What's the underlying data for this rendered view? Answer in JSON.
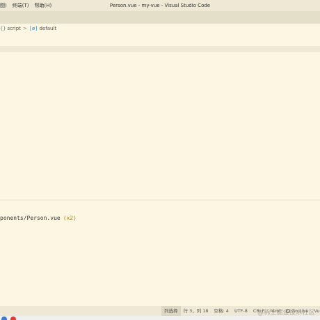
{
  "window": {
    "title": "Person.vue - my-vue - Visual Studio Code"
  },
  "menu": {
    "items": [
      {
        "label": "图)"
      },
      {
        "label": "终端(T)"
      },
      {
        "label": "帮助(H)"
      }
    ]
  },
  "breadcrumb": {
    "items": [
      {
        "icon": "{}",
        "icon_name": "braces-icon",
        "label": "script"
      },
      {
        "icon": "[ø]",
        "icon_name": "variable-icon",
        "label": "default"
      }
    ],
    "separator": ">"
  },
  "terminal": {
    "path_text": "ponents/Person.vue",
    "count_text": "(x2)"
  },
  "statusbar": {
    "items": [
      {
        "label": "列选择"
      },
      {
        "label": "行 3，列 18"
      },
      {
        "label": "空格: 4"
      },
      {
        "label": "UTF-8"
      },
      {
        "label": "CRLF"
      },
      {
        "label": "html"
      },
      {
        "label": "Go Live"
      },
      {
        "label": "Vue"
      }
    ]
  },
  "watermark": {
    "text": "@稀土掘金技术社区"
  },
  "colors": {
    "editor_background": "#fdf6e3",
    "titlebar_background": "#eee8d5",
    "tabstrip_background": "#e4dfc9",
    "statusbar_background": "#eee8d5",
    "terminal_highlight": "#b58900"
  }
}
